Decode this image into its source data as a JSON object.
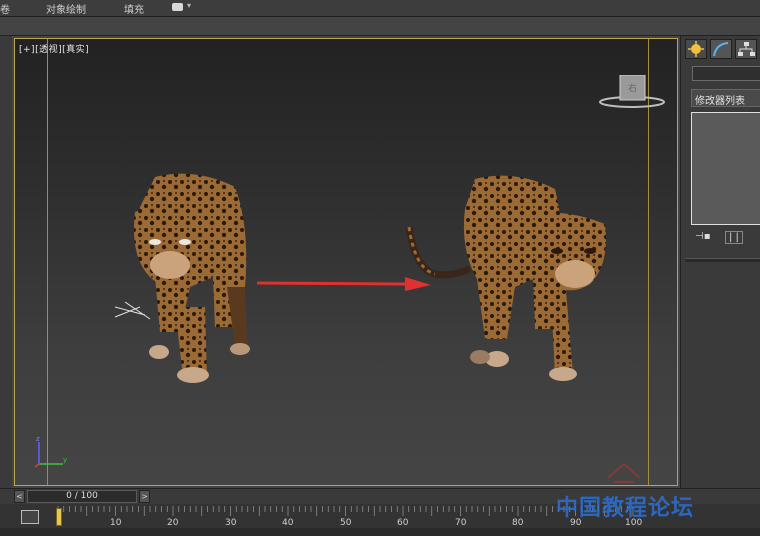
{
  "menu": {
    "items": [
      "卷",
      "对象绘制",
      "填充"
    ]
  },
  "viewport": {
    "label": "[+][透视][真实]",
    "viewcube_face": "右",
    "axis": {
      "x": "x",
      "y": "y",
      "z": "z"
    }
  },
  "command_panel": {
    "modifier_list": "修改器列表"
  },
  "timeline": {
    "frame_display": "0 / 100",
    "prev_label": "<",
    "next_label": ">",
    "ticks": [
      "10",
      "20",
      "30",
      "40",
      "50",
      "60",
      "70",
      "80",
      "90",
      "100"
    ]
  },
  "watermark": {
    "text": "中国教程论坛"
  },
  "colors": {
    "viewport_border": "#b8a64a",
    "arrow": "#e03030",
    "watermark": "#2c6fd6",
    "frame_marker": "#e8c84a"
  },
  "icons": [
    "light-icon",
    "curve-icon",
    "hierarchy-icon",
    "pin-icon",
    "show-result-icon",
    "track-icon"
  ]
}
